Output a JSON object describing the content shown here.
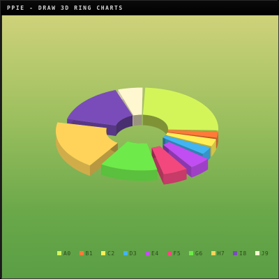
{
  "window": {
    "title": "PPIE - DRAW 3D RING CHARTS"
  },
  "chart_data": {
    "type": "pie",
    "variant": "3d-ring",
    "title": "",
    "legend_position": "bottom",
    "categories": [
      "A0",
      "B1",
      "C2",
      "D3",
      "E4",
      "F5",
      "G6",
      "H7",
      "I8",
      "J9"
    ],
    "values": [
      22,
      2.5,
      3,
      3,
      4.5,
      5,
      11,
      17,
      14,
      5
    ],
    "exploded": [
      false,
      false,
      false,
      false,
      true,
      true,
      false,
      true,
      false,
      false
    ],
    "colors": [
      "#d4f55a",
      "#ff7a38",
      "#ffef56",
      "#42b4f2",
      "#c14ef2",
      "#f2487e",
      "#6eea4a",
      "#ffd35a",
      "#7a4cba",
      "#fff7d0"
    ]
  }
}
